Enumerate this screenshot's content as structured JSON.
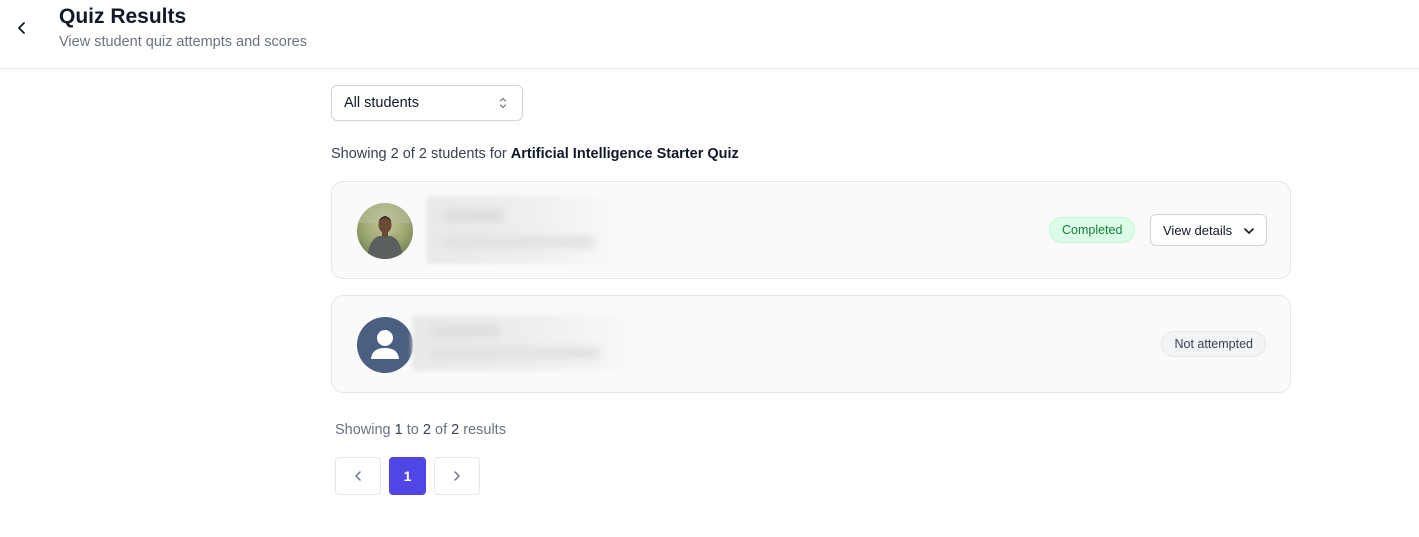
{
  "header": {
    "title": "Quiz Results",
    "subtitle": "View student quiz attempts and scores"
  },
  "filter": {
    "selected": "All students"
  },
  "summary": {
    "prefix": "Showing 2 of 2 students for",
    "quiz_name": "Artificial Intelligence Starter Quiz"
  },
  "students": [
    {
      "status": "Completed",
      "action_label": "View details",
      "avatar": "photo"
    },
    {
      "status": "Not attempted",
      "avatar": "default-user-icon"
    }
  ],
  "results_text": {
    "showing": "Showing",
    "from": "1",
    "to_word": "to",
    "to": "2",
    "of_word": "of",
    "total": "2",
    "results_word": "results"
  },
  "pagination": {
    "current_page": "1"
  },
  "colors": {
    "accent": "#4f46e5",
    "completed_bg": "#dcfce7",
    "completed_text": "#15803d",
    "default_avatar": "#4b5f82"
  }
}
